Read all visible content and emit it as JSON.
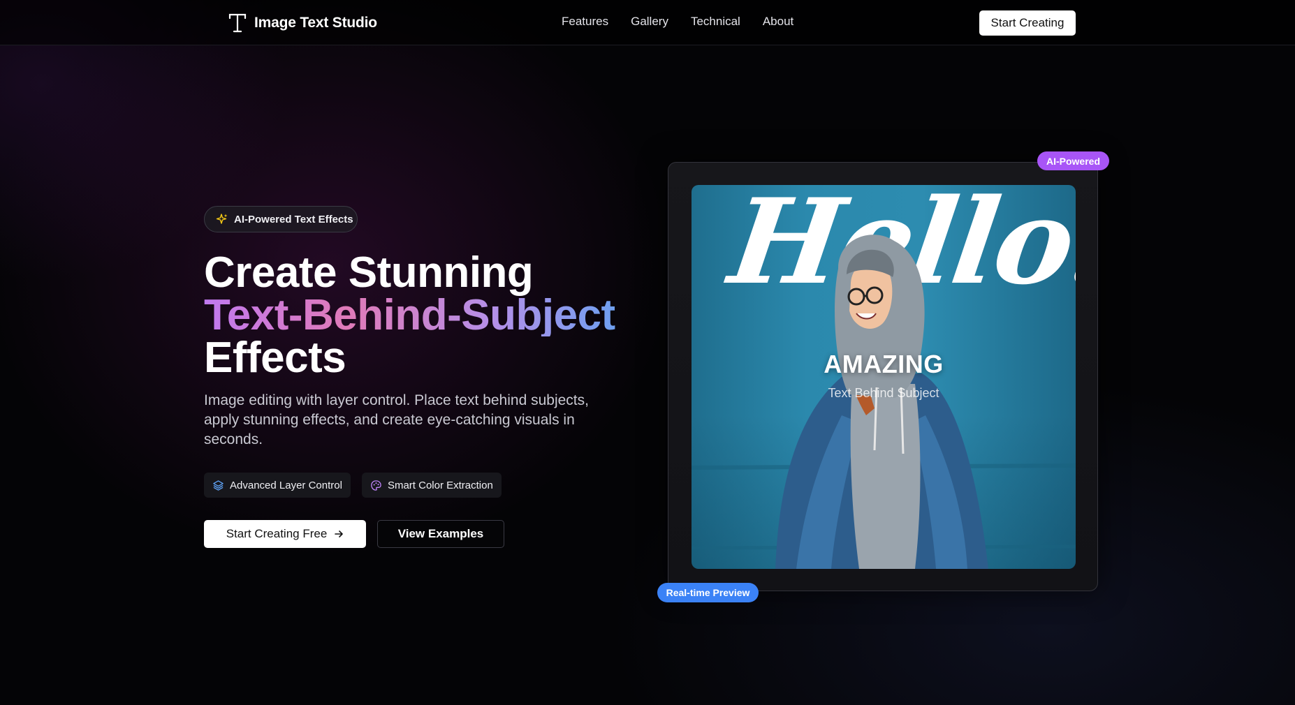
{
  "nav": {
    "brand": "Image Text Studio",
    "links": [
      "Features",
      "Gallery",
      "Technical",
      "About"
    ],
    "cta": "Start Creating"
  },
  "hero": {
    "pill": "AI-Powered Text Effects",
    "headline_line1": "Create Stunning",
    "headline_line2": "Text-Behind-Subject",
    "headline_line3": "Effects",
    "subtitle": "Image editing with layer control. Place text behind subjects, apply stunning effects, and create eye-catching visuals in seconds.",
    "chips": [
      "Advanced Layer Control",
      "Smart Color Extraction"
    ],
    "primary_button": "Start Creating Free",
    "secondary_button": "View Examples"
  },
  "preview": {
    "hello_text": "Hello!",
    "overlay_title": "AMAZING",
    "overlay_subtitle": "Text Behind Subject",
    "badge_top": "AI-Powered",
    "badge_bottom": "Real-time Preview"
  },
  "colors": {
    "accent_purple": "#a855f7",
    "accent_blue": "#3b82f6",
    "sparkle_yellow": "#facc15"
  },
  "icons": {
    "brand": "text-t-icon",
    "pill": "sparkles-icon",
    "chip_layers": "layers-icon",
    "chip_palette": "palette-icon",
    "arrow": "arrow-right-icon"
  }
}
